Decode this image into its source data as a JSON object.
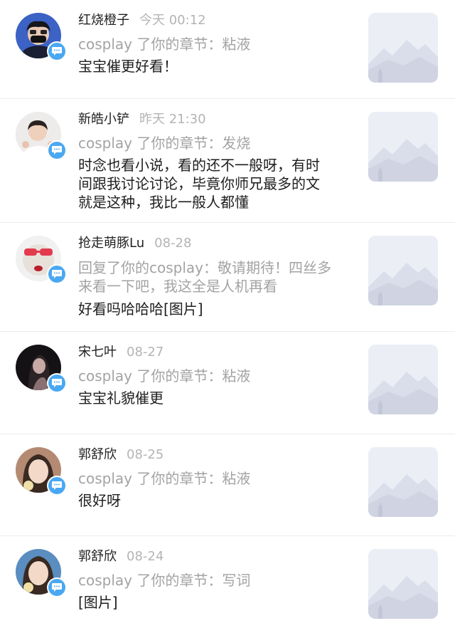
{
  "notifications": [
    {
      "username": "红烧橙子",
      "time": "今天 00:12",
      "context": "cosplay 了你的章节：粘液",
      "comment": "宝宝催更好看！"
    },
    {
      "username": "新皓小铲",
      "time": "昨天 21:30",
      "context": "cosplay 了你的章节：发烧",
      "comment_lines": [
        "时念也看小说，看的还不一般呀，有时",
        "间跟我讨论讨论，毕竟你师兄最多的文",
        "就是这种，我比一般人都懂"
      ]
    },
    {
      "username": "抢走萌豚Lu",
      "time": "08-28",
      "context_lines": [
        "回复了你的cosplay：敬请期待！四丝多",
        "来看一下吧，我这全是人机再看"
      ],
      "comment": "好看吗哈哈哈[图片]"
    },
    {
      "username": "宋七叶",
      "time": "08-27",
      "context": "cosplay 了你的章节：粘液",
      "comment": "宝宝礼貌催更"
    },
    {
      "username": "郭舒欣",
      "time": "08-25",
      "context": "cosplay 了你的章节：粘液",
      "comment": "很好呀"
    },
    {
      "username": "郭舒欣",
      "time": "08-24",
      "context": "cosplay 了你的章节：写词",
      "comment": "[图片]"
    }
  ],
  "icons": {
    "badge": "comment-bubble-icon",
    "thumbnail": "mountain-moon-placeholder-icon"
  },
  "colors": {
    "badge": "#4aa8f2",
    "thumbnail_bg": "#eceef6",
    "username": "#222222",
    "time": "#b4b4b4",
    "context": "#a3a3a3",
    "comment": "#1e1e1e",
    "divider": "#ececec"
  }
}
